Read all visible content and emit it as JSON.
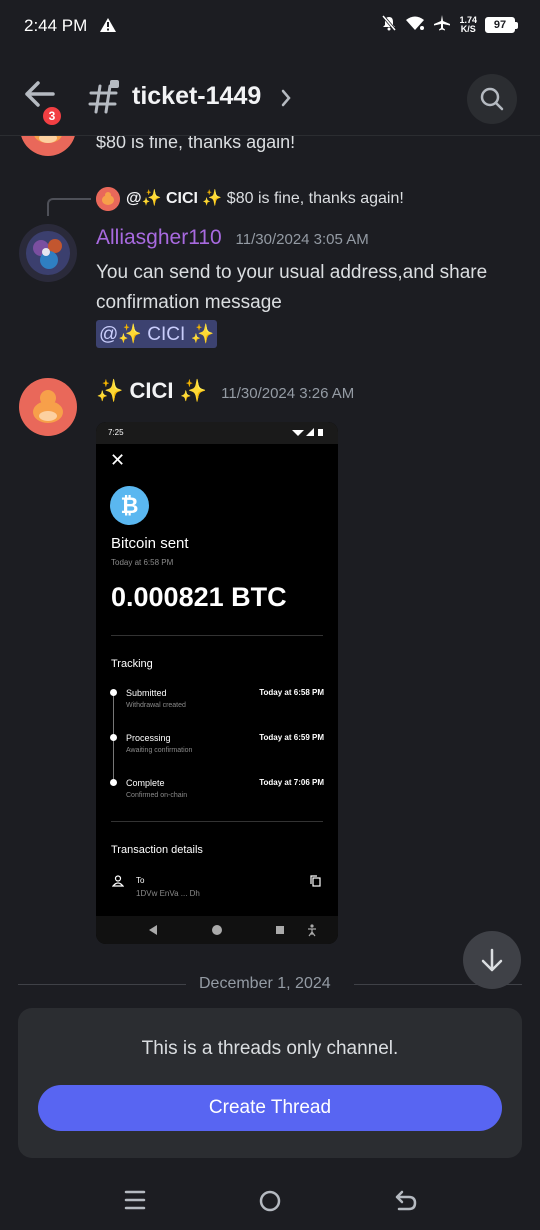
{
  "status_bar": {
    "time": "2:44 PM",
    "speed_value": "1.74",
    "speed_unit": "K/S",
    "battery": "97"
  },
  "header": {
    "badge_count": "3",
    "channel_name": "ticket-1449"
  },
  "messages": {
    "previous_text": "$80 is fine, thanks again!",
    "reply": {
      "author": "@✨ CICI ✨",
      "text": "$80 is fine, thanks again!"
    },
    "msg1": {
      "author": "Alliasgher110",
      "timestamp": "11/30/2024 3:05 AM",
      "text": "You  can send to your usual address,and share confirmation message",
      "mention": "@✨ CICI ✨"
    },
    "msg2": {
      "author": "✨ CICI ✨",
      "timestamp": "11/30/2024 3:26 AM"
    }
  },
  "attachment": {
    "status_time": "7:25",
    "title": "Bitcoin sent",
    "date": "Today at 6:58 PM",
    "amount": "0.000821 BTC",
    "tracking_label": "Tracking",
    "steps": [
      {
        "title": "Submitted",
        "sub": "Withdrawal created",
        "time": "Today at 6:58 PM"
      },
      {
        "title": "Processing",
        "sub": "Awaiting confirmation",
        "time": "Today at 6:59 PM"
      },
      {
        "title": "Complete",
        "sub": "Confirmed on-chain",
        "time": "Today at 7:06 PM"
      }
    ],
    "tx_details_label": "Transaction details",
    "to_label": "To",
    "to_address": "1DVw EnVa ... Dh"
  },
  "date_divider": "December 1, 2024",
  "threads_panel": {
    "notice": "This is a threads only channel.",
    "button": "Create Thread"
  },
  "colors": {
    "background": "#1c1d22",
    "accent": "#5865f2",
    "author_purple": "#a86ae0",
    "badge_red": "#f23f43",
    "btc_blue": "#5ab7f0"
  }
}
